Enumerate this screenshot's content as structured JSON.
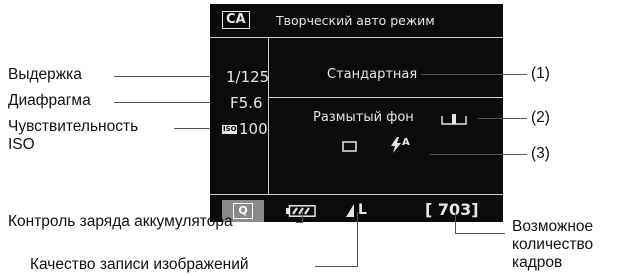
{
  "labels": {
    "shutter": "Выдержка",
    "aperture": "Диафрагма",
    "iso_line1": "Чувствительность",
    "iso_line2": "ISO",
    "battery": "Контроль заряда аккумулятора",
    "quality": "Качество записи изображений",
    "shots_line1": "Возможное",
    "shots_line2": "количество",
    "shots_line3": "кадров",
    "c1": "(1)",
    "c2": "(2)",
    "c3": "(3)"
  },
  "screen": {
    "mode_icon": "CA",
    "mode_title": "Творческий авто режим",
    "shutter_value": "1/125",
    "aperture_value": "F5.6",
    "iso_icon": "ISO",
    "iso_value": "100",
    "picture_style": "Стандартная",
    "background_blur": "Размытый фон",
    "q_button": "Q",
    "quality_value": "L",
    "shots_remaining": "[ 703]",
    "flash_mode": "A"
  },
  "icons": [
    "ca-mode-icon",
    "blur-scale-icon",
    "single-shot-icon",
    "flash-auto-icon",
    "q-icon",
    "battery-icon",
    "quality-icon"
  ],
  "colors": {
    "screen_bg": "#0b0b0b",
    "screen_text": "#e6e6e6",
    "q_button": "#8a8a8a"
  }
}
